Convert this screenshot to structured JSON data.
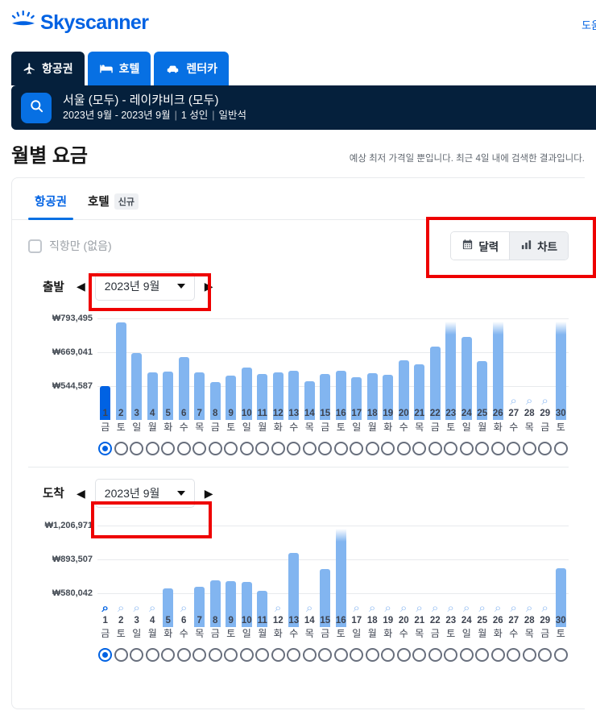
{
  "brand": {
    "name": "Skyscanner",
    "color": "#0062e3",
    "logo_icon": "sun-horizon-icon"
  },
  "topnav": {
    "help_label": "도움"
  },
  "vertical_tabs": [
    {
      "label": "항공권",
      "icon": "airplane-icon",
      "active": true
    },
    {
      "label": "호텔",
      "icon": "bed-icon",
      "active": false
    },
    {
      "label": "렌터카",
      "icon": "car-icon",
      "active": false
    }
  ],
  "search_summary": {
    "icon": "search-icon",
    "route": "서울 (모두) - 레이캬비크 (모두)",
    "dates": "2023년 9월 - 2023년 9월",
    "passengers": "1 성인",
    "cabin": "일반석"
  },
  "page": {
    "title": "월별 요금",
    "disclaimer": "예상 최저 가격일 뿐입니다. 최근 4일 내에 검색한 결과입니다."
  },
  "inner_tabs": [
    {
      "label": "항공권",
      "badge": "",
      "active": true
    },
    {
      "label": "호텔",
      "badge": "신규",
      "active": false
    }
  ],
  "filters": {
    "direct_only_label": "직항만 (없음)",
    "direct_only_checked": false
  },
  "view_toggle": {
    "calendar": {
      "label": "달력",
      "icon": "calendar-icon",
      "active": false
    },
    "chart": {
      "label": "차트",
      "icon": "bar-chart-icon",
      "active": true
    }
  },
  "chart_data": [
    {
      "type": "bar",
      "id": "departure",
      "title": "출발",
      "direction_label": "출발",
      "month_value": "2023년 9월",
      "prev_icon": "chevron-left-icon",
      "next_icon": "chevron-right-icon",
      "dropdown_icon": "chevron-down-icon",
      "ylabel": "",
      "xlabel": "",
      "ytick_labels": [
        "₩793,495",
        "₩669,041",
        "₩544,587"
      ],
      "ytick_values": [
        793495,
        669041,
        544587
      ],
      "ylim": [
        420133,
        793495
      ],
      "grid": true,
      "legend": "none",
      "categories": [
        "1",
        "2",
        "3",
        "4",
        "5",
        "6",
        "7",
        "8",
        "9",
        "10",
        "11",
        "12",
        "13",
        "14",
        "15",
        "16",
        "17",
        "18",
        "19",
        "20",
        "21",
        "22",
        "23",
        "24",
        "25",
        "26",
        "27",
        "28",
        "29",
        "30"
      ],
      "weekdays": [
        "금",
        "토",
        "일",
        "월",
        "화",
        "수",
        "목",
        "금",
        "토",
        "일",
        "월",
        "화",
        "수",
        "목",
        "금",
        "토",
        "일",
        "월",
        "화",
        "수",
        "목",
        "금",
        "토",
        "일",
        "월",
        "화",
        "수",
        "목",
        "금",
        "토"
      ],
      "values": [
        544587,
        778000,
        666000,
        595000,
        597000,
        650000,
        594000,
        560000,
        583000,
        613000,
        590000,
        596000,
        600000,
        562000,
        588000,
        600000,
        578000,
        591000,
        586000,
        640000,
        625000,
        690000,
        810000,
        725000,
        636000,
        812000,
        null,
        null,
        null,
        812000
      ],
      "value_labels": [
        "₩544,587",
        "",
        "",
        "",
        "",
        "",
        "",
        "",
        "",
        "",
        "",
        "",
        "",
        "",
        "",
        "",
        "",
        "",
        "",
        "",
        "",
        "",
        "",
        "",
        "",
        "",
        "",
        "",
        "",
        ""
      ],
      "no_data_indices": [
        27,
        28,
        29
      ],
      "no_data_icon": "magnifier-icon",
      "selected_index": 1,
      "bar_color": "#82b5f0",
      "selected_bar_color": "#0062e3",
      "radio_count": 30,
      "radio_selected": 1
    },
    {
      "type": "bar",
      "id": "arrival",
      "title": "도착",
      "direction_label": "도착",
      "month_value": "2023년 9월",
      "prev_icon": "chevron-left-icon",
      "next_icon": "chevron-right-icon",
      "dropdown_icon": "chevron-down-icon",
      "ylabel": "",
      "xlabel": "",
      "ytick_labels": [
        "₩1,206,971",
        "₩893,507",
        "₩580,042"
      ],
      "ytick_values": [
        1206971,
        893507,
        580042
      ],
      "ylim": [
        266578,
        1206971
      ],
      "grid": true,
      "legend": "none",
      "categories": [
        "1",
        "2",
        "3",
        "4",
        "5",
        "6",
        "7",
        "8",
        "9",
        "10",
        "11",
        "12",
        "13",
        "14",
        "15",
        "16",
        "17",
        "18",
        "19",
        "20",
        "21",
        "22",
        "23",
        "24",
        "25",
        "26",
        "27",
        "28",
        "29",
        "30"
      ],
      "weekdays": [
        "금",
        "토",
        "일",
        "월",
        "화",
        "수",
        "목",
        "금",
        "토",
        "일",
        "월",
        "화",
        "수",
        "목",
        "금",
        "토",
        "일",
        "월",
        "화",
        "수",
        "목",
        "금",
        "토",
        "일",
        "월",
        "화",
        "수",
        "목",
        "금",
        "토"
      ],
      "values": [
        null,
        null,
        null,
        null,
        620000,
        null,
        640000,
        700000,
        690000,
        680000,
        600000,
        null,
        950000,
        null,
        800000,
        1240000,
        null,
        null,
        null,
        null,
        null,
        null,
        null,
        null,
        null,
        null,
        null,
        null,
        null,
        810000
      ],
      "no_data_indices": [
        0,
        1,
        2,
        3,
        5,
        11,
        13,
        16,
        17,
        18,
        19,
        20,
        21,
        22,
        23,
        24,
        25,
        26,
        27,
        28
      ],
      "no_data_icon": "magnifier-icon",
      "selected_index": 0,
      "bar_color": "#82b5f0",
      "selected_bar_color": "#0062e3",
      "radio_count": 30,
      "radio_selected": 1
    }
  ],
  "annotations": {
    "highlight_color": "#ee0000",
    "boxes": [
      {
        "name": "view-toggle-highlight"
      },
      {
        "name": "departure-month-highlight"
      },
      {
        "name": "arrival-month-highlight"
      }
    ]
  }
}
